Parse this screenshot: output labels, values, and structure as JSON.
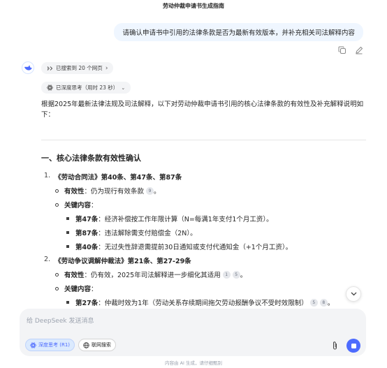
{
  "page_title": "劳动仲裁申请书生成指南",
  "user_message": "请确认申请书中引用的法律条款是否为最新有效版本，并补充相关司法解释内容",
  "chips": {
    "search": "已搜索到 20 个网页",
    "think": "已深度思考（用时 23 秒）"
  },
  "answer": {
    "intro": "根据2025年最新法律法规及司法解释，以下对劳动仲裁申请书引用的核心法律条款的有效性及补充解释说明如下：",
    "section_title": "一、核心法律条款有效性确认",
    "items": [
      {
        "num": "1.",
        "title": "《劳动合同法》第40条、第47条、第87条",
        "validity_label": "有效性",
        "validity_text": "：仍为现行有效条款",
        "validity_cites": [
          "9"
        ],
        "key_label": "关键内容",
        "key_colon": "：",
        "subs": [
          {
            "label": "第47条",
            "text": "：经济补偿按工作年限计算（N=每满1年支付1个月工资）。"
          },
          {
            "label": "第87条",
            "text": "：违法解除需支付赔偿金（2N）。"
          },
          {
            "label": "第40条",
            "text": "：无过失性辞退需提前30日通知或支付代通知金（+1个月工资）。"
          }
        ]
      },
      {
        "num": "2.",
        "title": "《劳动争议调解仲裁法》第21条、第27-29条",
        "validity_label": "有效性",
        "validity_text": "：仍有效，2025年司法解释进一步细化其适用",
        "validity_cites": [
          "1",
          "5"
        ],
        "key_label": "关键内容",
        "key_colon": "：",
        "subs": [
          {
            "label": "第27条",
            "text": "：仲裁时效为1年（劳动关系存续期间拖欠劳动报酬争议不受时效限制）",
            "cites": [
              "5",
              "8"
            ]
          }
        ]
      }
    ]
  },
  "input": {
    "placeholder": "给 DeepSeek 发送消息",
    "deep_think_label": "深度思考 (R1)",
    "web_search_label": "联网搜索"
  },
  "footer_note": "内容由 AI 生成，请仔细甄别",
  "colors": {
    "accent": "#4d6bfe",
    "user_bubble": "#eff6ff",
    "input_bg": "#f3f4f6"
  }
}
